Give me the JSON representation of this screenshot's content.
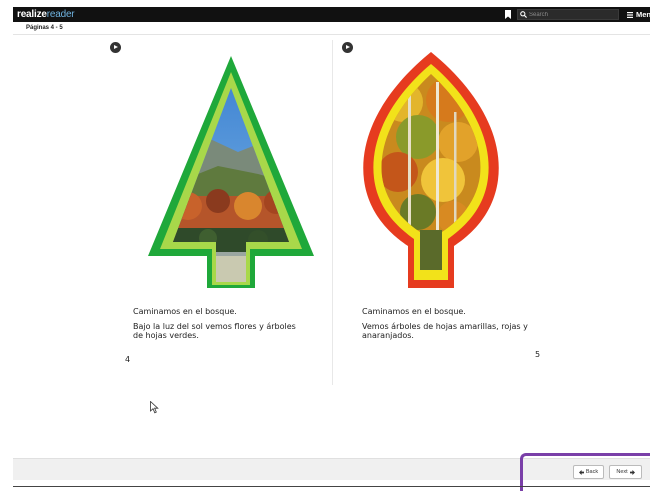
{
  "header": {
    "logo_main": "realize",
    "logo_accent": "reader",
    "search_placeholder": "Search",
    "menu_label": "Menu",
    "icons": [
      "bookmark-icon",
      "search-icon",
      "hamburger-icon"
    ]
  },
  "subheader": {
    "pages_label": "Páginas 4 - 5"
  },
  "left_page": {
    "line1": "Caminamos en el bosque.",
    "line2": "Bajo la luz del sol vemos flores y árboles de hojas verdes.",
    "number": "4"
  },
  "right_page": {
    "line1": "Caminamos en el bosque.",
    "line2": "Vemos árboles de hojas amarillas, rojas y anaranjados.",
    "number": "5"
  },
  "footer": {
    "back_label": "Back",
    "next_label": "Next"
  },
  "colors": {
    "topbar": "#111111",
    "tree_outer": "#1fa83a",
    "tree_inner": "#a8d84a",
    "leaf_outer": "#e63b1f",
    "leaf_inner": "#f2e21a",
    "highlight": "#7a3fa8"
  }
}
